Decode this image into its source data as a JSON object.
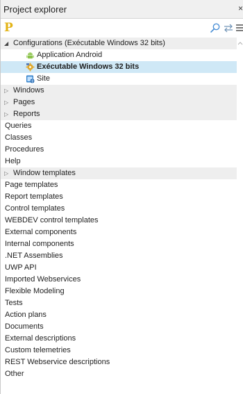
{
  "window": {
    "title": "Project explorer",
    "close_label": "×"
  },
  "toolbar": {
    "logo_letter": "P",
    "icons": [
      "search-icon",
      "sync-icon",
      "menu-icon"
    ]
  },
  "colors": {
    "logo": "#e3b418",
    "selected_row": "#cfe8f6",
    "shaded_row": "#eeeeee",
    "android_green": "#8bc34a",
    "exe_gold": "#e0a72a",
    "site_blue": "#2f7fc9"
  },
  "tree": {
    "configurations": {
      "label": "Configurations (Exécutable Windows 32 bits)",
      "expanded": true,
      "children": [
        {
          "label": "Application Android",
          "icon": "android-icon"
        },
        {
          "label": "Exécutable Windows 32 bits",
          "icon": "executable-icon",
          "selected": true
        },
        {
          "label": "Site",
          "icon": "site-icon"
        }
      ]
    },
    "collapsible": [
      {
        "label": "Windows"
      },
      {
        "label": "Pages"
      },
      {
        "label": "Reports"
      }
    ],
    "plain_items_a": [
      {
        "label": "Queries"
      },
      {
        "label": "Classes"
      },
      {
        "label": "Procedures"
      },
      {
        "label": "Help"
      }
    ],
    "window_templates": {
      "label": "Window templates"
    },
    "plain_items_b": [
      {
        "label": "Page templates"
      },
      {
        "label": "Report templates"
      },
      {
        "label": "Control templates"
      },
      {
        "label": "WEBDEV control templates"
      },
      {
        "label": "External components"
      },
      {
        "label": "Internal components"
      },
      {
        "label": ".NET Assemblies"
      },
      {
        "label": "UWP API"
      },
      {
        "label": "Imported Webservices"
      },
      {
        "label": "Flexible Modeling"
      },
      {
        "label": "Tests"
      },
      {
        "label": "Action plans"
      },
      {
        "label": "Documents"
      },
      {
        "label": "External descriptions"
      },
      {
        "label": "Custom telemetries"
      },
      {
        "label": "REST Webservice descriptions"
      },
      {
        "label": "Other"
      }
    ]
  }
}
